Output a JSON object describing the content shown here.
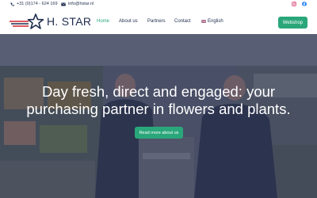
{
  "topbar": {
    "phone": "+31 (0)174 - 624 169",
    "email": "info@hstar.nl",
    "phone_icon": "phone-icon",
    "mail_icon": "mail-icon",
    "instagram_icon": "instagram-icon",
    "facebook_icon": "facebook-icon"
  },
  "header": {
    "logo_text": "H. STAR",
    "nav": {
      "home": "Home",
      "about": "About us",
      "partners": "Partners",
      "contact": "Contact",
      "language": "English"
    },
    "webshop_label": "Webshop"
  },
  "hero": {
    "headline": "Day fresh, direct and engaged: your purchasing partner in flowers and plants.",
    "cta_label": "Read more about us"
  },
  "colors": {
    "accent": "#2aa77a",
    "navy": "#1f2d4d",
    "brand_red": "#d2232a"
  }
}
